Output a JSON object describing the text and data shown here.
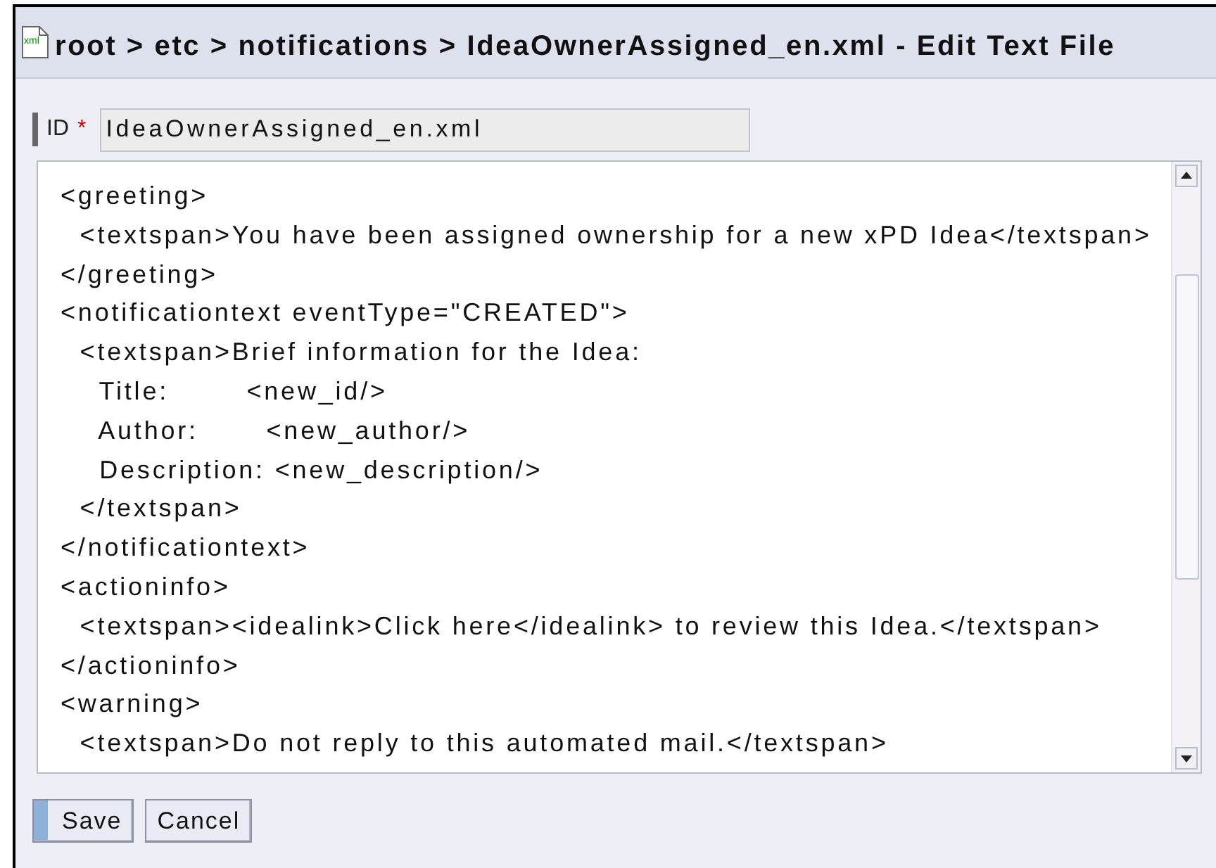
{
  "header": {
    "icon_text": "xml",
    "title": "root > etc > notifications > IdeaOwnerAssigned_en.xml - Edit Text File"
  },
  "id_field": {
    "label": "ID",
    "required_mark": "*",
    "value": "IdeaOwnerAssigned_en.xml"
  },
  "editor": {
    "lines": [
      "<greeting>",
      "  <textspan>You have been assigned ownership for a new xPD Idea</textspan>",
      "</greeting>",
      "<notificationtext eventType=\"CREATED\">",
      "  <textspan>Brief information for the Idea:",
      "    Title:        <new_id/>",
      "    Author:       <new_author/>",
      "    Description: <new_description/>",
      "  </textspan>",
      "</notificationtext>",
      "<actioninfo>",
      "  <textspan><idealink>Click here</idealink> to review this Idea.</textspan>",
      "</actioninfo>",
      "<warning>",
      "  <textspan>Do not reply to this automated mail.</textspan>"
    ]
  },
  "buttons": [
    {
      "label": "Save",
      "kind": "primary"
    },
    {
      "label": "Cancel",
      "kind": "secondary"
    }
  ]
}
